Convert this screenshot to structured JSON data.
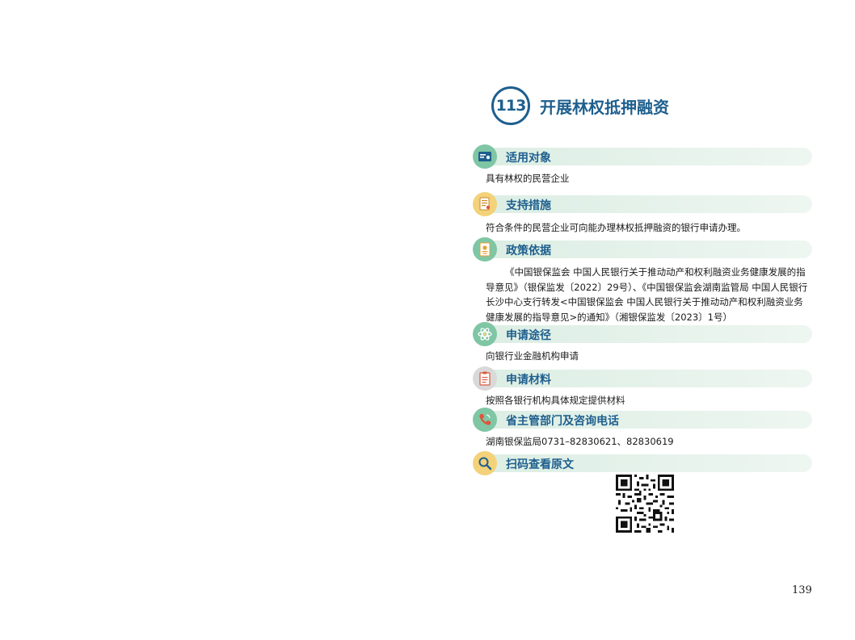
{
  "title": {
    "number": "113",
    "text": "开展林权抵押融资"
  },
  "sections": [
    {
      "heading": "适用对象",
      "icon": "id-card-icon",
      "body": "具有林权的民营企业"
    },
    {
      "heading": "支持措施",
      "icon": "document-pen-icon",
      "body": "符合条件的民营企业可向能办理林权抵押融资的银行申请办理。"
    },
    {
      "heading": "政策依据",
      "icon": "certificate-icon",
      "body": "《中国银保监会 中国人民银行关于推动动产和权利融资业务健康发展的指导意见》（银保监发〔2022〕29号）、《中国银保监会湖南监管局 中国人民银行长沙中心支行转发<中国银保监会 中国人民银行关于推动动产和权利融资业务健康发展的指导意见>的通知》（湘银保监发〔2023〕1号）"
    },
    {
      "heading": "申请途径",
      "icon": "atom-icon",
      "body": "向银行业金融机构申请"
    },
    {
      "heading": "申请材料",
      "icon": "clipboard-icon",
      "body": "按照各银行机构具体规定提供材料"
    },
    {
      "heading": "省主管部门及咨询电话",
      "icon": "phone-icon",
      "body": "湖南银保监局0731–82830621、82830619"
    },
    {
      "heading": "扫码查看原文",
      "icon": "magnifier-icon",
      "body": ""
    }
  ],
  "page_number": "139",
  "colors": {
    "accent": "#1e5f8e",
    "band": "#dceee4"
  }
}
